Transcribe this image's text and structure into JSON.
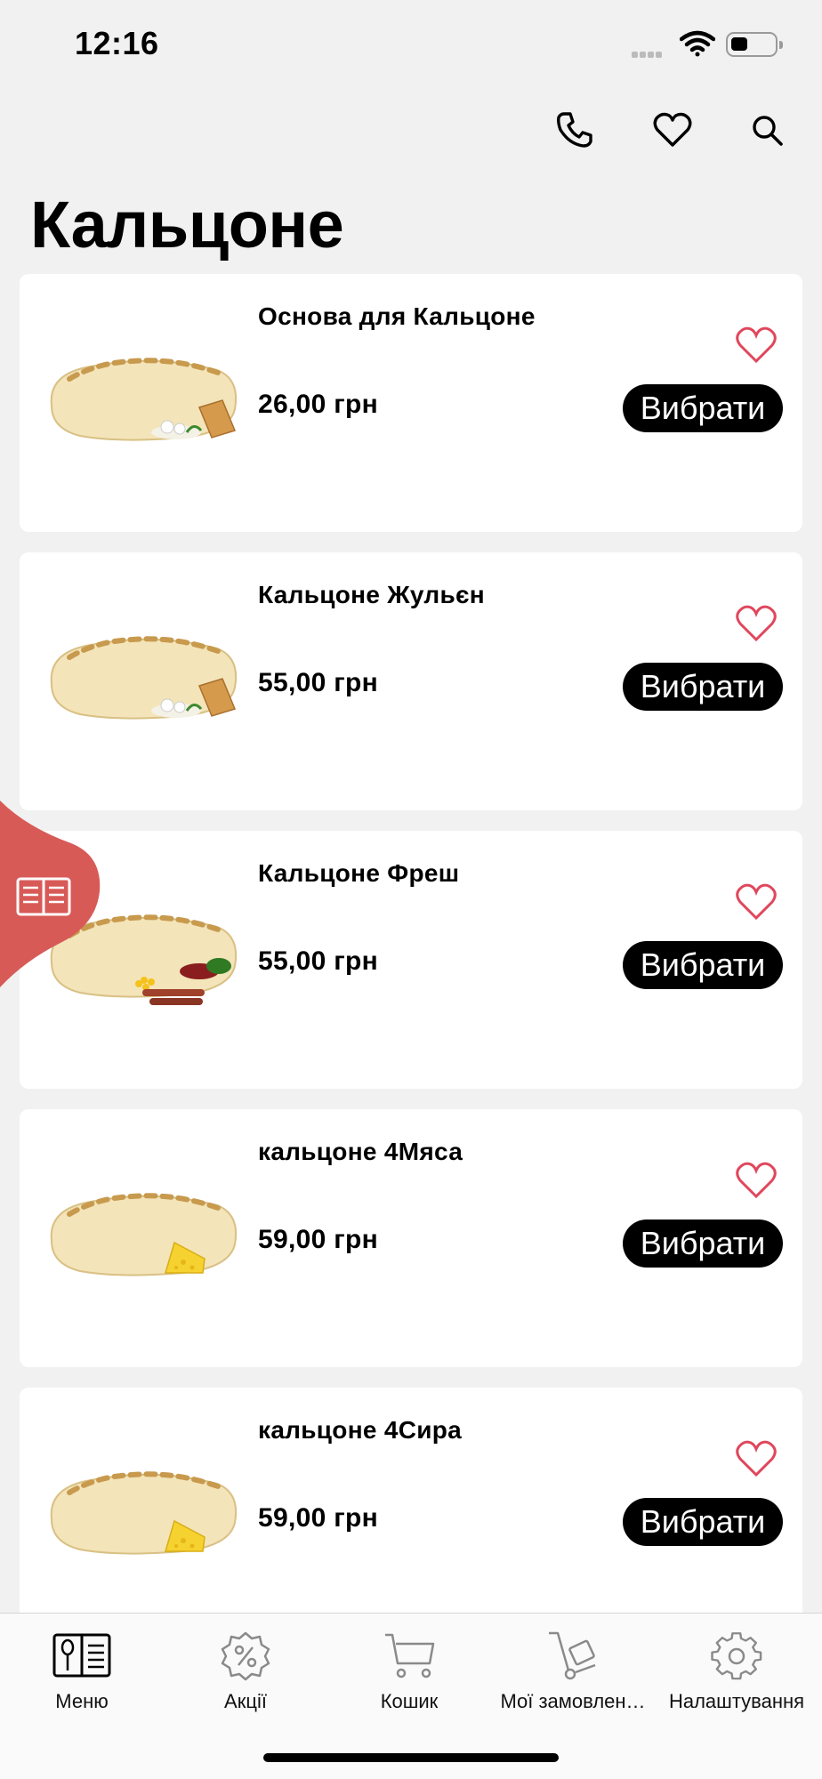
{
  "status_bar": {
    "time": "12:16"
  },
  "header": {
    "title": "Кальцоне",
    "icons": [
      "phone-icon",
      "heart-icon",
      "search-icon"
    ]
  },
  "products": [
    {
      "name": "Основа для Кальцоне",
      "price": "26,00 грн",
      "button": "Вибрати",
      "topping": "mushrooms"
    },
    {
      "name": "Кальцоне Жульєн",
      "price": "55,00 грн",
      "button": "Вибрати",
      "topping": "mushrooms"
    },
    {
      "name": "Кальцоне Фреш",
      "price": "55,00 грн",
      "button": "Вибрати",
      "topping": "sausage-corn"
    },
    {
      "name": "кальцоне 4Мяса",
      "price": "59,00 грн",
      "button": "Вибрати",
      "topping": "cheese"
    },
    {
      "name": "кальцоне 4Сира",
      "price": "59,00 грн",
      "button": "Вибрати",
      "topping": "cheese"
    }
  ],
  "side_tab": {
    "icon": "book-icon",
    "color": "#d85a57"
  },
  "tab_bar": {
    "tabs": [
      {
        "label": "Меню",
        "icon": "menu-book-icon",
        "active": true
      },
      {
        "label": "Акції",
        "icon": "discount-icon",
        "active": false
      },
      {
        "label": "Кошик",
        "icon": "cart-icon",
        "active": false
      },
      {
        "label": "Мої замовлен…",
        "icon": "orders-icon",
        "active": false
      },
      {
        "label": "Налаштування",
        "icon": "settings-icon",
        "active": false
      }
    ]
  },
  "colors": {
    "accent": "#e0475c",
    "background": "#f1f1f1",
    "button": "#000000"
  }
}
